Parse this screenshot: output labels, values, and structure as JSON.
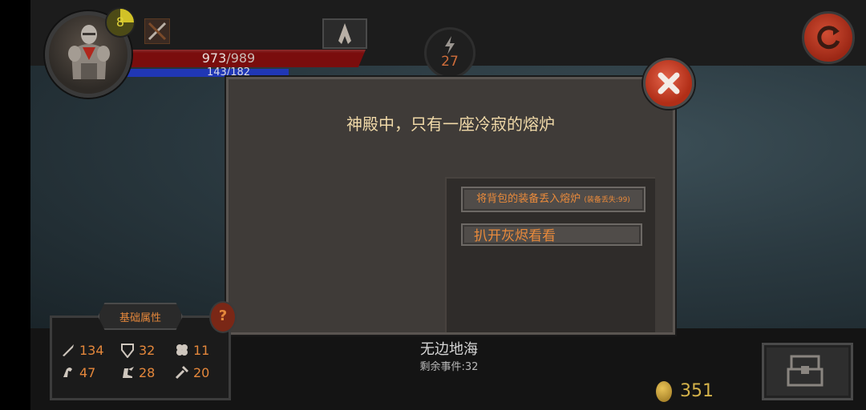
{
  "player": {
    "level": "8",
    "hp_current": "973",
    "hp_max": "989",
    "mp_current": "143",
    "mp_max": "182",
    "hp_fraction": 0.984,
    "mp_fraction": 0.786
  },
  "energy": "27",
  "dialog": {
    "title": "神殿中，只有一座冷寂的熔炉",
    "choices": [
      {
        "label": "将背包的装备丢入熔炉",
        "note": "(装备丢失:99)"
      },
      {
        "label": "扒开灰烬看看",
        "note": ""
      }
    ]
  },
  "attributes": {
    "title": "基础属性",
    "stats": [
      {
        "icon": "sword-icon",
        "value": "134"
      },
      {
        "icon": "shield-icon",
        "value": "32"
      },
      {
        "icon": "clover-icon",
        "value": "11"
      },
      {
        "icon": "arm-icon",
        "value": "47"
      },
      {
        "icon": "winged-boot-icon",
        "value": "28"
      },
      {
        "icon": "hammer-icon",
        "value": "20"
      }
    ]
  },
  "help_label": "?",
  "location": {
    "name": "无边地海",
    "events_label": "剩余事件:32"
  },
  "gold": "351",
  "colors": {
    "accent_orange": "#e4873b",
    "hp_red": "#7a0d0d",
    "mp_blue": "#2037b5",
    "close_red": "#c93d24",
    "dialog_title": "#f0d9a8"
  }
}
